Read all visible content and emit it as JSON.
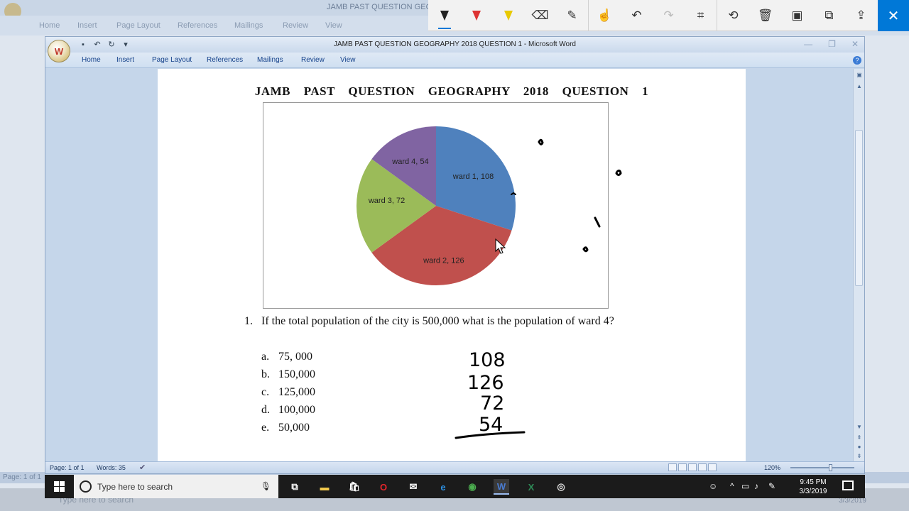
{
  "background": {
    "title": "JAMB PAST QUESTION GEOG",
    "tabs": [
      "Home",
      "Insert",
      "Page Layout",
      "References",
      "Mailings",
      "Review",
      "View"
    ],
    "status": "Page: 1 of 1",
    "search_placeholder": "Type here to search",
    "date": "3/3/2019"
  },
  "annotation_toolbar": {
    "tools": [
      "ballpoint-pen",
      "pencil-red",
      "highlighter",
      "eraser",
      "ruler",
      "touch-writing",
      "undo",
      "redo",
      "crop",
      "history",
      "delete",
      "save",
      "copy",
      "share"
    ],
    "selected_tool": "ballpoint-pen",
    "accent_color": "#0078d7",
    "close_label": "✕"
  },
  "word": {
    "title": "JAMB PAST QUESTION GEOGRAPHY 2018 QUESTION 1  -  Microsoft Word",
    "office_button_label": "W",
    "tabs": [
      {
        "label": "Home"
      },
      {
        "label": "Insert"
      },
      {
        "label": "Page Layout"
      },
      {
        "label": "References"
      },
      {
        "label": "Mailings"
      },
      {
        "label": "Review"
      },
      {
        "label": "View"
      }
    ],
    "help_label": "?",
    "status": {
      "page": "Page: 1 of 1",
      "words": "Words: 35",
      "zoom": "120%"
    }
  },
  "document": {
    "heading": "JAMB PAST QUESTION GEOGRAPHY 2018 QUESTION 1",
    "question_number": "1.",
    "question_text": "If the total population of the city is 500,000 what is the population of ward 4?",
    "options": [
      {
        "letter": "a.",
        "value": "75, 000"
      },
      {
        "letter": "b.",
        "value": "150,000"
      },
      {
        "letter": "c.",
        "value": "125,000"
      },
      {
        "letter": "d.",
        "value": "100,000"
      },
      {
        "letter": "e.",
        "value": "50,000"
      }
    ],
    "handwritten_sum": [
      "108",
      "126",
      "72",
      "54"
    ]
  },
  "chart_data": {
    "type": "pie",
    "labels": [
      "ward 1",
      "ward 2",
      "ward 3",
      "ward 4"
    ],
    "values": [
      108,
      126,
      72,
      54
    ],
    "slice_labels": [
      "ward 1, 108",
      "ward 2, 126",
      "ward 3, 72",
      "ward 4, 54"
    ],
    "colors": [
      "#4f81bd",
      "#c0504d",
      "#9bbb59",
      "#8064a2"
    ]
  },
  "taskbar": {
    "search_placeholder": "Type here to search",
    "time": "9:45 PM",
    "date": "3/3/2019",
    "apps": [
      "task-view",
      "file-explorer",
      "store",
      "opera",
      "mail",
      "edge",
      "chrome",
      "word",
      "excel",
      "obs"
    ]
  }
}
